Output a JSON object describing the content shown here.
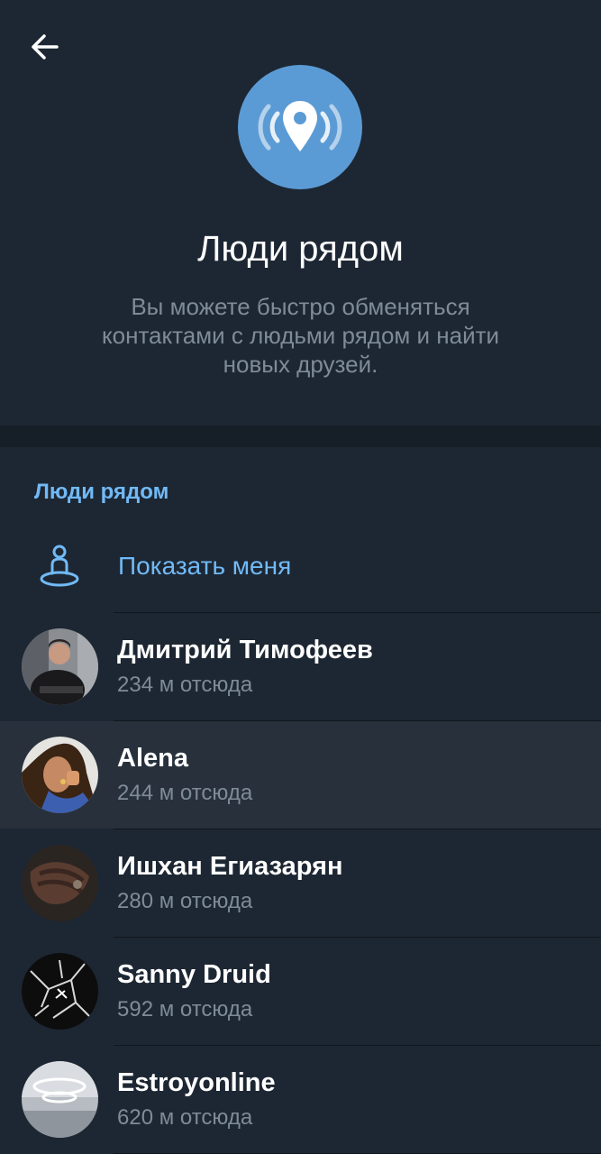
{
  "header": {
    "back_icon": "arrow-left-icon"
  },
  "hero": {
    "icon": "location-pin-radar-icon",
    "accent_color": "#5b9bd5",
    "title": "Люди рядом",
    "description_line1": "Вы можете быстро обменяться",
    "description_line2": "контактами с людьми рядом и найти",
    "description_line3": "новых друзей."
  },
  "list": {
    "section_title": "Люди рядом",
    "show_me": {
      "icon": "person-on-location-icon",
      "label": "Показать меня"
    },
    "users": [
      {
        "name": "Дмитрий Тимофеев",
        "distance": "234 м отсюда",
        "avatar": "person-photo-suit"
      },
      {
        "name": "Alena",
        "distance": "244 м отсюда",
        "avatar": "person-photo-woman"
      },
      {
        "name": "Ишхан Егиазарян",
        "distance": "280 м отсюда",
        "avatar": "hand-photo"
      },
      {
        "name": "Sanny Druid",
        "distance": "592 м отсюда",
        "avatar": "cracked-dark-pattern"
      },
      {
        "name": "Estroyonline",
        "distance": "620 м отсюда",
        "avatar": "ceiling-lights-photo"
      }
    ]
  },
  "colors": {
    "background": "#1d2733",
    "link": "#71baf7",
    "secondary_text": "#7f8b98",
    "highlight_row": "#27303b"
  }
}
